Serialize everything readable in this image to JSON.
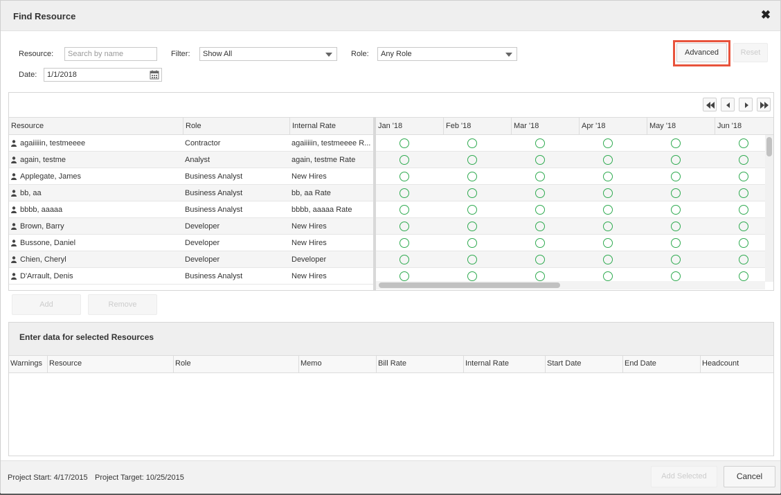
{
  "dialog": {
    "title": "Find Resource"
  },
  "filters": {
    "resource_label": "Resource:",
    "resource_placeholder": "Search by name",
    "filter_label": "Filter:",
    "filter_value": "Show All",
    "role_label": "Role:",
    "role_value": "Any Role",
    "date_label": "Date:",
    "date_value": "1/1/2018",
    "advanced_label": "Advanced",
    "reset_label": "Reset"
  },
  "grid": {
    "columns": [
      "Resource",
      "Role",
      "Internal Rate"
    ],
    "months": [
      "Jan '18",
      "Feb '18",
      "Mar '18",
      "Apr '18",
      "May '18",
      "Jun '18"
    ],
    "rows": [
      {
        "resource": "agaiiiiin, testmeeee",
        "role": "Contractor",
        "rate": "agaiiiiin, testmeeee R..."
      },
      {
        "resource": "again, testme",
        "role": "Analyst",
        "rate": "again, testme Rate"
      },
      {
        "resource": "Applegate, James",
        "role": "Business Analyst",
        "rate": "New Hires"
      },
      {
        "resource": "bb, aa",
        "role": "Business Analyst",
        "rate": "bb, aa Rate"
      },
      {
        "resource": "bbbb, aaaaa",
        "role": "Business Analyst",
        "rate": "bbbb, aaaaa Rate"
      },
      {
        "resource": "Brown, Barry",
        "role": "Developer",
        "rate": "New Hires"
      },
      {
        "resource": "Bussone, Daniel",
        "role": "Developer",
        "rate": "New Hires"
      },
      {
        "resource": "Chien, Cheryl",
        "role": "Developer",
        "rate": "Developer"
      },
      {
        "resource": "D'Arrault, Denis",
        "role": "Business Analyst",
        "rate": "New Hires"
      }
    ],
    "add_label": "Add",
    "remove_label": "Remove",
    "availability_color": "#2eaa4f"
  },
  "selected": {
    "title": "Enter data for selected Resources",
    "columns": [
      "Warnings",
      "Resource",
      "Role",
      "Memo",
      "Bill Rate",
      "Internal Rate",
      "Start Date",
      "End Date",
      "Headcount"
    ]
  },
  "footer": {
    "project_start": "Project Start: 4/17/2015",
    "project_target": "Project Target: 10/25/2015",
    "add_selected_label": "Add Selected",
    "cancel_label": "Cancel"
  },
  "colors": {
    "highlight": "#e8533c"
  }
}
